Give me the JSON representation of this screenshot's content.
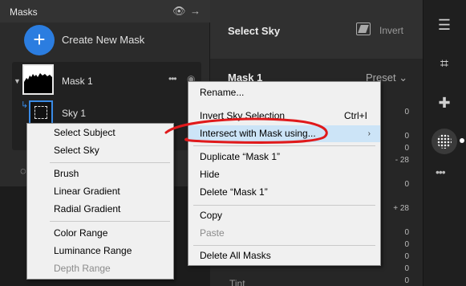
{
  "masks_panel": {
    "title": "Masks",
    "eye_icon": "eye-icon",
    "arrow_icon": "arrow-right-icon",
    "create_label": "Create New Mask",
    "items": [
      {
        "label": "Mask 1",
        "icon": "mask-thumbnail"
      },
      {
        "label": "Sky 1",
        "icon": "sky-thumbnail"
      }
    ]
  },
  "right_panel": {
    "title": "Select Sky",
    "invert_label": "Invert",
    "mask_name": "Mask 1",
    "preset_label": "Preset",
    "values": [
      "0",
      "0",
      "0",
      "- 28",
      "0",
      "+ 28",
      "0",
      "0",
      "0",
      "0",
      "0"
    ],
    "tint_label": "Tint"
  },
  "context_menu": {
    "items": [
      "Rename...",
      "Invert Sky Selection",
      "Intersect with Mask using...",
      "Duplicate “Mask 1”",
      "Hide",
      "Delete “Mask 1”",
      "Copy",
      "Paste",
      "Delete All Masks"
    ],
    "shortcut_invert": "Ctrl+I",
    "submenu_arrow": "›"
  },
  "submenu": {
    "items": [
      "Select Subject",
      "Select Sky",
      "Brush",
      "Linear Gradient",
      "Radial Gradient",
      "Color Range",
      "Luminance Range",
      "Depth Range"
    ]
  },
  "toolbar": {
    "tools": [
      "sliders-icon",
      "crop-icon",
      "heal-icon",
      "masking-icon",
      "more-icon"
    ]
  },
  "colors": {
    "accent": "#2b7de0",
    "annotation": "#e0191b",
    "menu_bg": "#f0f0f0",
    "menu_hover": "#cce4f7"
  }
}
